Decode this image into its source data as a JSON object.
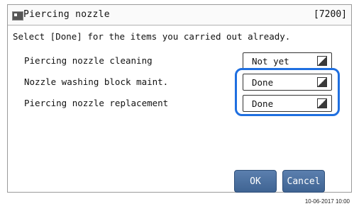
{
  "window": {
    "title": "Piercing nozzle",
    "screen_code": "[7200]"
  },
  "instruction": "Select [Done] for the items you carried out already.",
  "items": [
    {
      "label": "Piercing nozzle cleaning",
      "value": "Not yet"
    },
    {
      "label": "Nozzle washing block maint.",
      "value": "Done"
    },
    {
      "label": "Piercing nozzle replacement",
      "value": "Done"
    }
  ],
  "buttons": {
    "ok": "OK",
    "cancel": "Cancel"
  },
  "timestamp": "10-06-2017 10:00",
  "colors": {
    "highlight": "#1f6fe0",
    "button": "#4a6f9f"
  }
}
